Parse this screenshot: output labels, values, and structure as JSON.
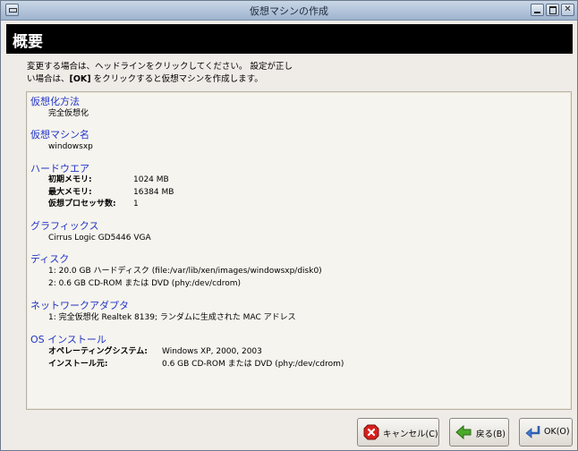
{
  "window": {
    "title": "仮想マシンの作成"
  },
  "header": {
    "title": "概要"
  },
  "intro": {
    "line1": "変更する場合は、ヘッドラインをクリックしてください。 設定が正し",
    "line2_pre": "い場合は、",
    "line2_bold": "[OK]",
    "line2_post": " をクリックすると仮想マシンを作成します。"
  },
  "sections": {
    "virt_method": {
      "title": "仮想化方法",
      "value": "完全仮想化"
    },
    "vm_name": {
      "title": "仮想マシン名",
      "value": "windowsxp"
    },
    "hardware": {
      "title": "ハードウエア",
      "initial_mem_label": "初期メモリ:",
      "initial_mem_value": "1024 MB",
      "max_mem_label": "最大メモリ:",
      "max_mem_value": "16384 MB",
      "vcpu_label": "仮想プロセッサ数:",
      "vcpu_value": "1"
    },
    "graphics": {
      "title": "グラフィックス",
      "value": "Cirrus Logic GD5446 VGA"
    },
    "disk": {
      "title": "ディスク",
      "item1": "1: 20.0 GB ハードディスク (file:/var/lib/xen/images/windowsxp/disk0)",
      "item2": "2: 0.6 GB CD-ROM または DVD (phy:/dev/cdrom)"
    },
    "network": {
      "title": "ネットワークアダプタ",
      "item1": "1: 完全仮想化 Realtek 8139; ランダムに生成された MAC アドレス"
    },
    "os_install": {
      "title": "OS インストール",
      "os_label": "オペレーティングシステム:",
      "os_value": "Windows XP, 2000, 2003",
      "source_label": "インストール元:",
      "source_value": "0.6 GB CD-ROM または DVD (phy:/dev/cdrom)"
    }
  },
  "buttons": {
    "cancel": "キャンセル(C)",
    "back": "戻る(B)",
    "ok": "OK(O)"
  },
  "colors": {
    "section_title": "#2235c8",
    "header_bg": "#000000",
    "window_bg": "#efebe7"
  },
  "icons": {
    "cancel": "stop-x-icon",
    "back": "green-back-arrow-icon",
    "ok": "enter-arrow-icon"
  }
}
